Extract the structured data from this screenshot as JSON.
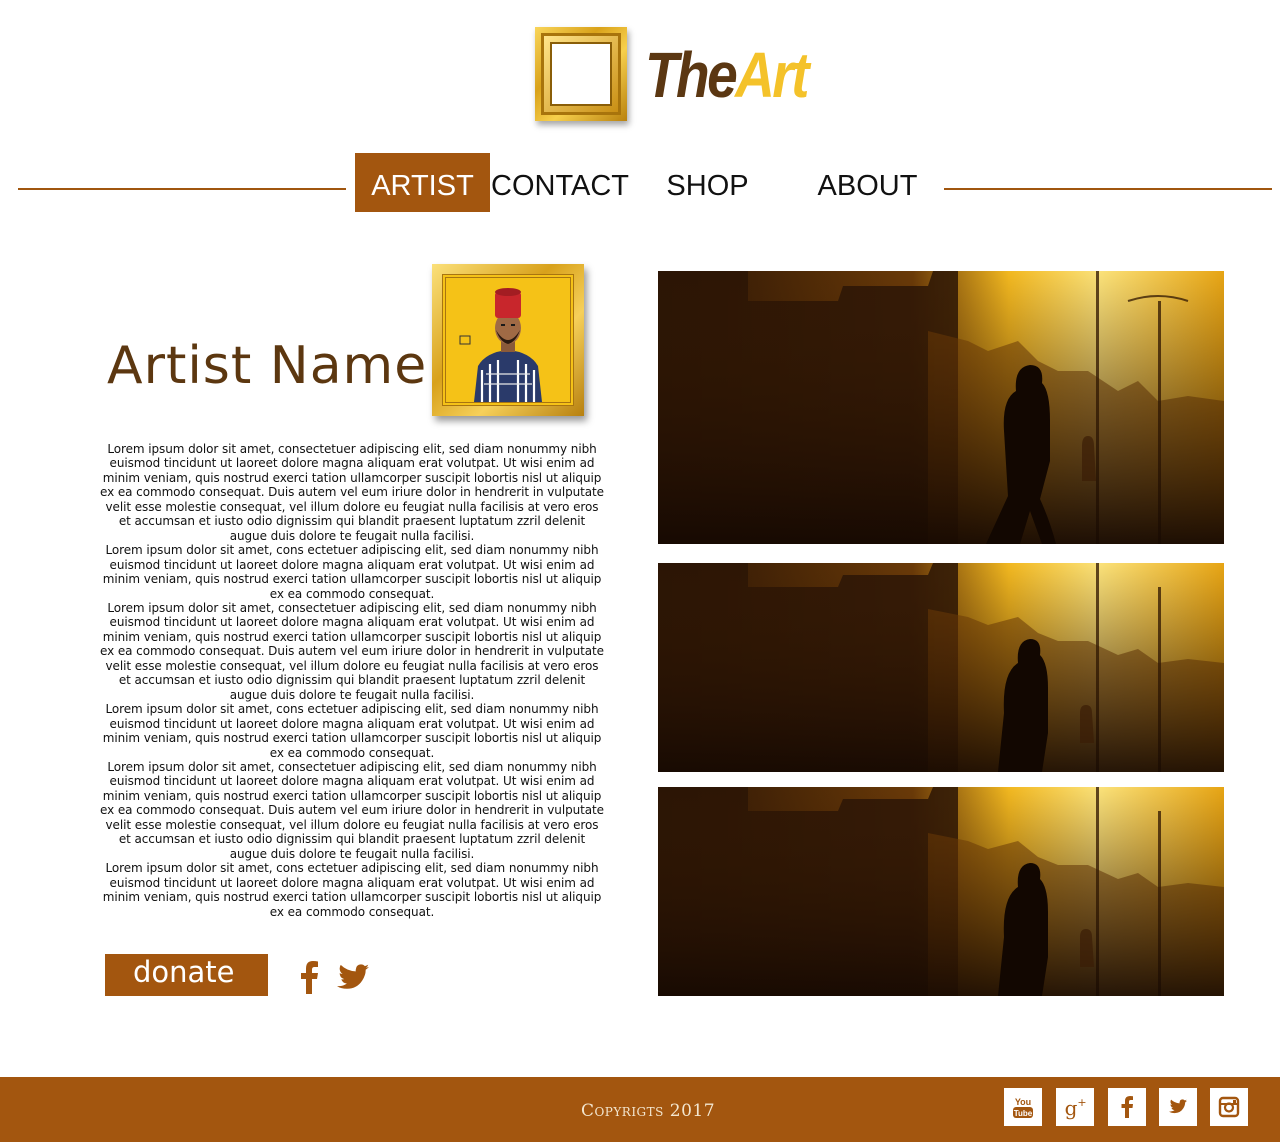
{
  "brand": {
    "part1": "The",
    "part2": "Art"
  },
  "nav": {
    "items": [
      {
        "label": "ARTIST",
        "active": true
      },
      {
        "label": "CONTACT",
        "active": false
      },
      {
        "label": "SHOP",
        "active": false
      },
      {
        "label": "ABOUT",
        "active": false
      }
    ]
  },
  "artist": {
    "name": "Artist Name",
    "bio": [
      "Lorem ipsum dolor sit amet, consectetuer adipiscing elit, sed diam nonummy nibh euismod tincidunt ut laoreet dolore magna aliquam erat volutpat. Ut wisi enim ad minim veniam, quis nostrud exerci tation ullamcorper suscipit lobortis nisl ut aliquip ex ea commodo consequat. Duis autem vel eum iriure dolor in hendrerit in vulputate velit esse molestie consequat, vel illum dolore eu feugiat nulla facilisis at vero eros et accumsan et iusto odio dignissim qui blandit praesent luptatum zzril delenit augue duis dolore te feugait nulla facilisi.",
      "Lorem ipsum dolor sit amet, cons ectetuer adipiscing elit, sed diam nonummy nibh euismod tincidunt ut laoreet dolore magna aliquam erat volutpat. Ut wisi enim ad minim veniam, quis nostrud exerci tation ullamcorper suscipit lobortis nisl ut aliquip ex ea commodo consequat.",
      "Lorem ipsum dolor sit amet, consectetuer adipiscing elit, sed diam nonummy nibh euismod tincidunt ut laoreet dolore magna aliquam erat volutpat. Ut wisi enim ad minim veniam, quis nostrud exerci tation ullamcorper suscipit lobortis nisl ut aliquip ex ea commodo consequat. Duis autem vel eum iriure dolor in hendrerit in vulputate velit esse molestie consequat, vel illum dolore eu feugiat nulla facilisis at vero eros et accumsan et iusto odio dignissim qui blandit praesent luptatum zzril delenit augue duis dolore te feugait nulla facilisi.",
      "Lorem ipsum dolor sit amet, cons ectetuer adipiscing elit, sed diam nonummy nibh euismod tincidunt ut laoreet dolore magna aliquam erat volutpat. Ut wisi enim ad minim veniam, quis nostrud exerci tation ullamcorper suscipit lobortis nisl ut aliquip ex ea commodo consequat.",
      "Lorem ipsum dolor sit amet, consectetuer adipiscing elit, sed diam nonummy nibh euismod tincidunt ut laoreet dolore magna aliquam erat volutpat. Ut wisi enim ad minim veniam, quis nostrud exerci tation ullamcorper suscipit lobortis nisl ut aliquip ex ea commodo consequat. Duis autem vel eum iriure dolor in hendrerit in vulputate velit esse molestie consequat, vel illum dolore eu feugiat nulla facilisis at vero eros et accumsan et iusto odio dignissim qui blandit praesent luptatum zzril delenit augue duis dolore te feugait nulla facilisi.",
      "Lorem ipsum dolor sit amet, cons ectetuer adipiscing elit, sed diam nonummy nibh euismod tincidunt ut laoreet dolore magna aliquam erat volutpat. Ut wisi enim ad minim veniam, quis nostrud exerci tation ullamcorper suscipit lobortis nisl ut aliquip ex ea commodo consequat."
    ]
  },
  "donate": {
    "label": "donate"
  },
  "social": {
    "inline": [
      "facebook-icon",
      "twitter-icon"
    ],
    "footer": [
      "youtube-icon",
      "google-plus-icon",
      "facebook-icon",
      "twitter-icon",
      "instagram-icon"
    ]
  },
  "footer": {
    "copyright": "Copyrigts 2017"
  },
  "colors": {
    "accent": "#a3560f",
    "brand_dark": "#5b3712",
    "brand_gold": "#f4c22a",
    "footer_text": "#f3e6cf"
  }
}
